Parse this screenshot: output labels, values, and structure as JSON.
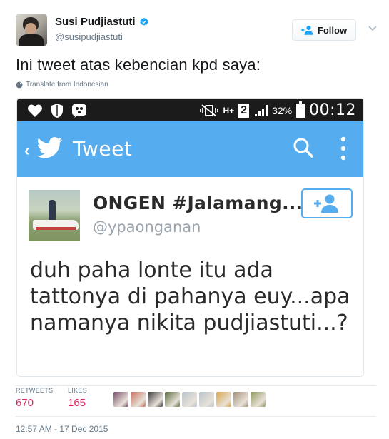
{
  "user": {
    "display_name": "Susi Pudjiastuti",
    "handle": "@susipudjiastuti",
    "verified_icon": "verified-badge-icon"
  },
  "actions": {
    "follow_label": "Follow",
    "follow_icon": "add-person-icon",
    "caret_icon": "chevron-down-icon"
  },
  "tweet": {
    "text": "Ini tweet atas kebencian kpd saya:",
    "translate_label": "Translate from Indonesian"
  },
  "media": {
    "status_bar": {
      "network": "H+",
      "sim": "2",
      "battery": "32%",
      "clock": "00:12"
    },
    "app_bar": {
      "back_glyph": "‹",
      "title": "Tweet",
      "icons": [
        "twitter-bird-icon",
        "search-icon",
        "more-vertical-icon"
      ]
    },
    "embedded_tweet": {
      "display_name": "ONGEN #Jalamang...",
      "handle": "@ypaonganan",
      "text": "duh paha lonte itu ada tattonya di pahanya euy...apa namanya nikita pudjiastuti...?"
    }
  },
  "stats": {
    "retweets_label": "RETWEETS",
    "retweets_value": "670",
    "likes_label": "LIKES",
    "likes_value": "165"
  },
  "likers": [
    {
      "color": "#7a4f6a"
    },
    {
      "color": "#c96f5e"
    },
    {
      "color": "#3b3b3b"
    },
    {
      "color": "#5a6b3f"
    },
    {
      "color": "#b9c4cc"
    },
    {
      "color": "#b9c4cc"
    },
    {
      "color": "#d8a64a"
    },
    {
      "color": "#a0907a"
    },
    {
      "color": "#8e9a5c"
    }
  ],
  "timestamp": "12:57 AM - 17 Dec 2015",
  "colors": {
    "twitter_blue": "#55acee",
    "like_red": "#e0245e",
    "secondary_text": "#657786"
  }
}
